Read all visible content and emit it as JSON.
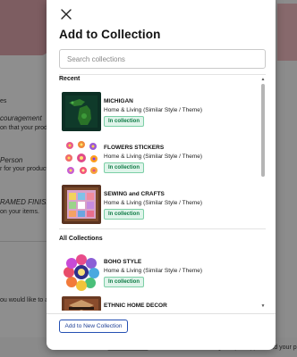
{
  "background": {
    "fragments": [
      "es",
      "couragement",
      "on that your product",
      "Person",
      "r for your product.",
      "RAMED FINISH",
      "on your items.",
      "ou would like to a",
      "Tags help shoppers find your p"
    ]
  },
  "modal": {
    "title": "Add to Collection",
    "close_icon": "close-icon"
  },
  "search": {
    "placeholder": "Search collections",
    "value": ""
  },
  "sections": {
    "recent_label": "Recent",
    "all_label": "All Collections"
  },
  "recent": [
    {
      "title": "MICHIGAN",
      "subtitle": "Home & Living  (Similar Style / Theme)",
      "badge": "In collection"
    },
    {
      "title": "FLOWERS STICKERS",
      "subtitle": "Home & Living  (Similar Style / Theme)",
      "badge": "In collection"
    },
    {
      "title": "SEWING and CRAFTS",
      "subtitle": "Home & Living  (Similar Style / Theme)",
      "badge": "In collection"
    }
  ],
  "all_collections": [
    {
      "title": "BOHO STYLE",
      "subtitle": "Home & Living  (Similar Style / Theme)",
      "badge": "In collection"
    },
    {
      "title": "ETHNIC HOME DECOR",
      "subtitle": "",
      "badge": ""
    }
  ],
  "footer": {
    "add_button_label": "Add to New Collection"
  },
  "colors": {
    "badge_bg": "#dff4ea",
    "badge_text": "#0e7a45",
    "accent_blue": "#1e3f95"
  }
}
